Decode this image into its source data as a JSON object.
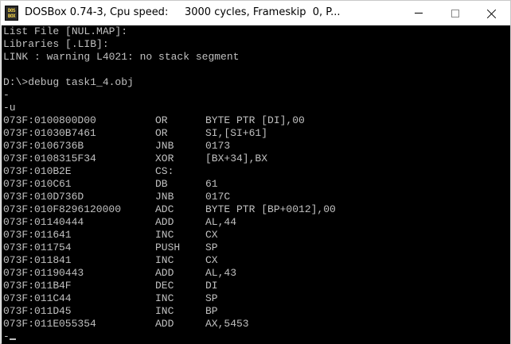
{
  "window": {
    "title": "DOSBox 0.74-3, Cpu speed:     3000 cycles, Frameskip  0, P...",
    "icon_text_top": "DOS",
    "icon_text_bottom": "BOX",
    "icon": "dosbox-icon",
    "controls": [
      "minimize-icon",
      "maximize-icon",
      "close-icon"
    ]
  },
  "console": {
    "header_lines": [
      "List File [NUL.MAP]:",
      "Libraries [.LIB]:",
      "LINK : warning L4021: no stack segment",
      "",
      "D:\\>debug task1_4.obj",
      "-",
      "-u"
    ],
    "disassembly": [
      {
        "addr": "073F:0100",
        "hex": "800D00",
        "mnemonic": "OR",
        "operands": "BYTE PTR [DI],00"
      },
      {
        "addr": "073F:0103",
        "hex": "0B7461",
        "mnemonic": "OR",
        "operands": "SI,[SI+61]"
      },
      {
        "addr": "073F:0106",
        "hex": "736B",
        "mnemonic": "JNB",
        "operands": "0173"
      },
      {
        "addr": "073F:0108",
        "hex": "315F34",
        "mnemonic": "XOR",
        "operands": "[BX+34],BX"
      },
      {
        "addr": "073F:010B",
        "hex": "2E",
        "mnemonic": "CS:",
        "operands": ""
      },
      {
        "addr": "073F:010C",
        "hex": "61",
        "mnemonic": "DB",
        "operands": "61"
      },
      {
        "addr": "073F:010D",
        "hex": "736D",
        "mnemonic": "JNB",
        "operands": "017C"
      },
      {
        "addr": "073F:010F",
        "hex": "8296120000",
        "mnemonic": "ADC",
        "operands": "BYTE PTR [BP+0012],00"
      },
      {
        "addr": "073F:0114",
        "hex": "0444",
        "mnemonic": "ADD",
        "operands": "AL,44"
      },
      {
        "addr": "073F:0116",
        "hex": "41",
        "mnemonic": "INC",
        "operands": "CX"
      },
      {
        "addr": "073F:0117",
        "hex": "54",
        "mnemonic": "PUSH",
        "operands": "SP"
      },
      {
        "addr": "073F:0118",
        "hex": "41",
        "mnemonic": "INC",
        "operands": "CX"
      },
      {
        "addr": "073F:0119",
        "hex": "0443",
        "mnemonic": "ADD",
        "operands": "AL,43"
      },
      {
        "addr": "073F:011B",
        "hex": "4F",
        "mnemonic": "DEC",
        "operands": "DI"
      },
      {
        "addr": "073F:011C",
        "hex": "44",
        "mnemonic": "INC",
        "operands": "SP"
      },
      {
        "addr": "073F:011D",
        "hex": "45",
        "mnemonic": "INC",
        "operands": "BP"
      },
      {
        "addr": "073F:011E",
        "hex": "055354",
        "mnemonic": "ADD",
        "operands": "AX,5453"
      }
    ],
    "prompt": "-",
    "colors": {
      "background": "#000000",
      "text": "#c0c0c0"
    }
  }
}
